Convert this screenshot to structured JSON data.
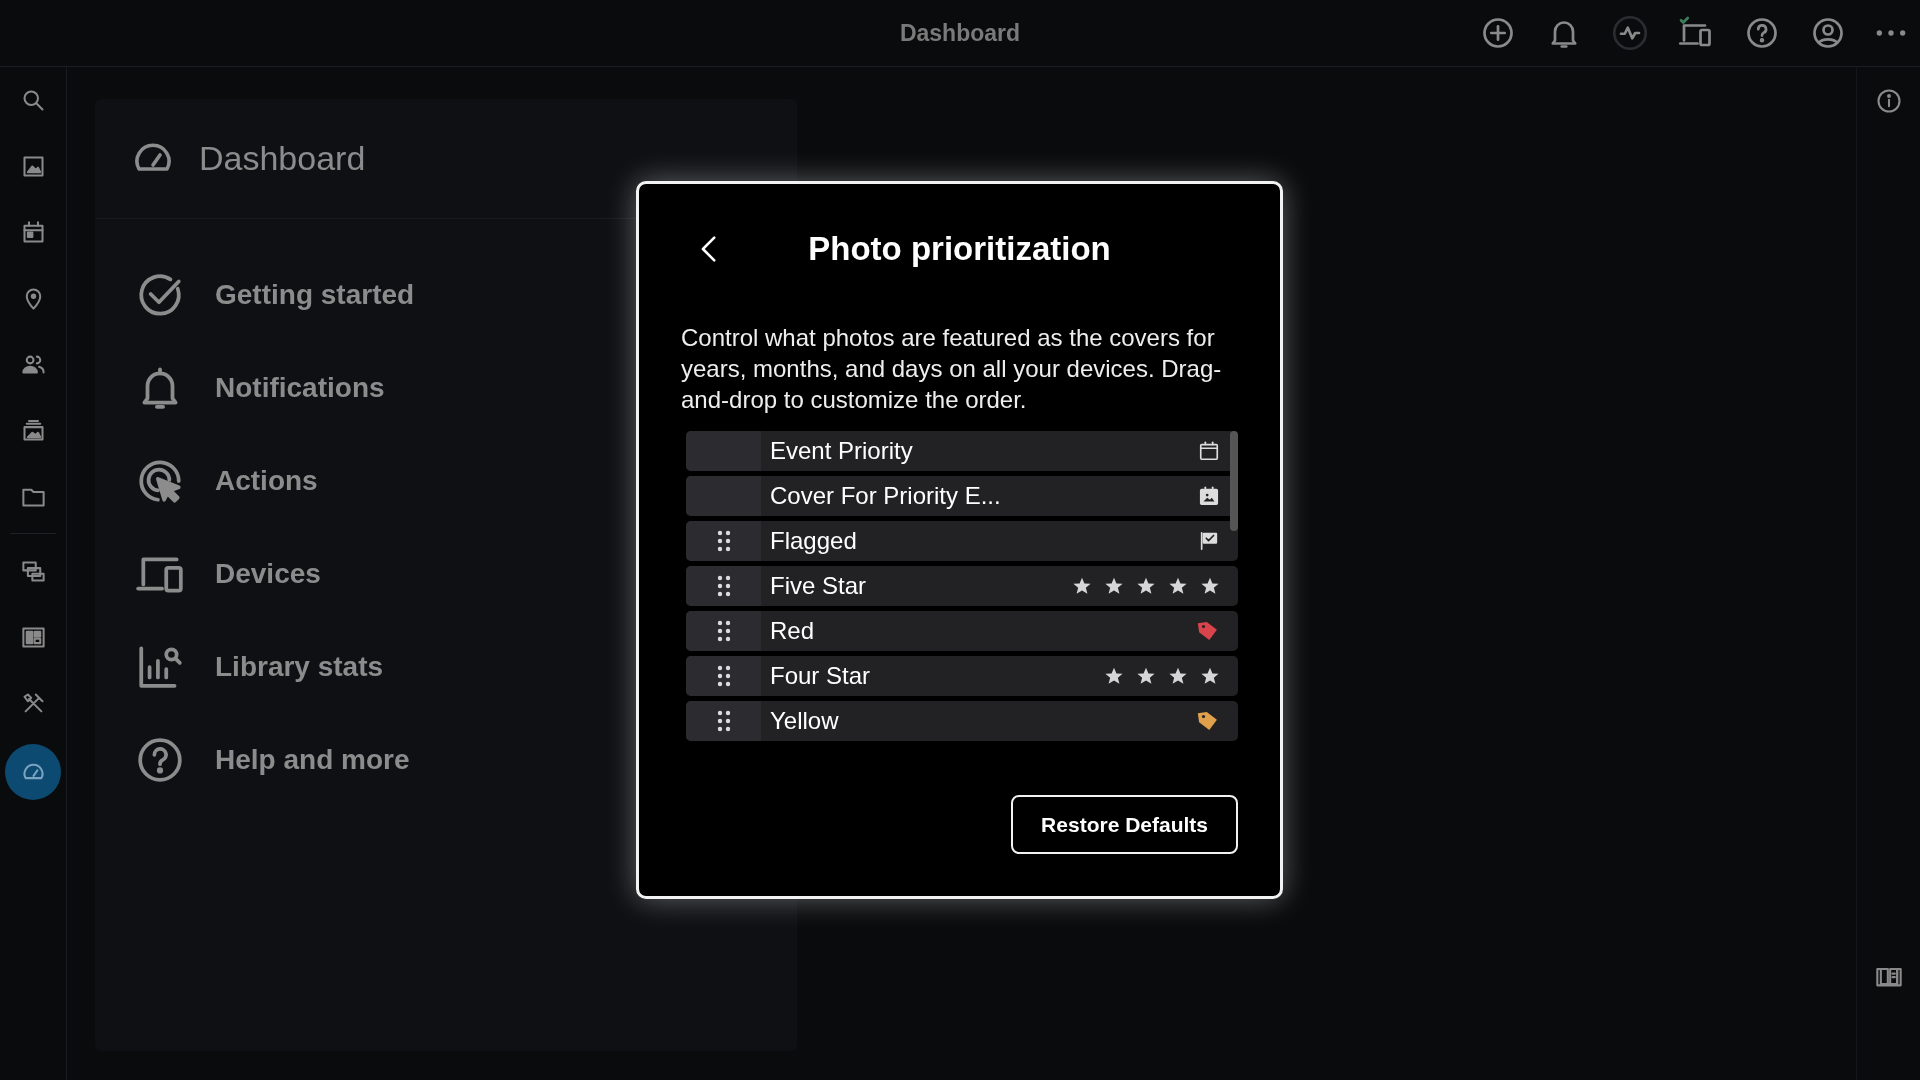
{
  "top_bar": {
    "title": "Dashboard"
  },
  "nav_rail": {
    "primary": [
      {
        "selected": false
      },
      {
        "selected": false
      },
      {
        "selected": false
      },
      {
        "selected": false
      },
      {
        "selected": false
      },
      {
        "selected": false
      },
      {
        "selected": false
      }
    ],
    "secondary": [
      {
        "selected": false
      },
      {
        "selected": false
      },
      {
        "selected": false
      },
      {
        "selected": true
      }
    ]
  },
  "panel": {
    "title": "Dashboard",
    "items": [
      {
        "label": "Getting started"
      },
      {
        "label": "Notifications"
      },
      {
        "label": "Actions"
      },
      {
        "label": "Devices"
      },
      {
        "label": "Library stats"
      },
      {
        "label": "Help and more"
      }
    ]
  },
  "dialog": {
    "title": "Photo prioritization",
    "description": "Control what photos are featured as the covers for years, months, and days on all your devices. Drag-and-drop to customize the order.",
    "rows": [
      {
        "label": "Event Priority",
        "draggable": false,
        "kind": "calendar"
      },
      {
        "label": "Cover For Priority E...",
        "draggable": false,
        "kind": "calendar-photo"
      },
      {
        "label": "Flagged",
        "draggable": true,
        "kind": "flag"
      },
      {
        "label": "Five Star",
        "draggable": true,
        "kind": "stars",
        "stars": 5
      },
      {
        "label": "Red",
        "draggable": true,
        "kind": "tag",
        "color": "#d9434b"
      },
      {
        "label": "Four Star",
        "draggable": true,
        "kind": "stars",
        "stars": 4
      },
      {
        "label": "Yellow",
        "draggable": true,
        "kind": "tag",
        "color": "#e0a04c"
      }
    ],
    "button": "Restore Defaults"
  }
}
